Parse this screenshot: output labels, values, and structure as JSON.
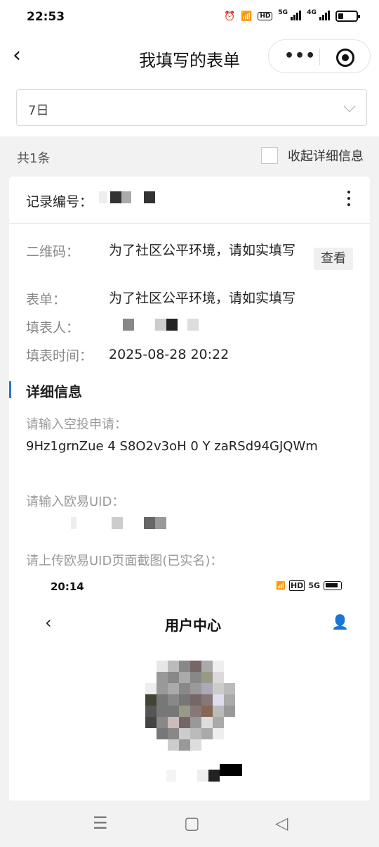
{
  "status_bar": {
    "time": "22:53",
    "network1": "5G",
    "network2": "4G",
    "hd": "HD",
    "icons": [
      "alarm-icon",
      "wifi-icon",
      "hd-icon",
      "signal-5g-icon",
      "signal-4g-icon",
      "battery-icon"
    ]
  },
  "nav": {
    "title": "我填写的表单"
  },
  "filter": {
    "selected": "7日"
  },
  "summary": {
    "count_text": "共1条",
    "collapse_label": "收起详细信息"
  },
  "record": {
    "id_label": "记录编号：",
    "fields": [
      {
        "key": "二维码：",
        "value": "为了社区公平环境，请如实填写"
      },
      {
        "key": "表单：",
        "value": "为了社区公平环境，请如实填写"
      },
      {
        "key": "填表人：",
        "value": ""
      },
      {
        "key": "填表时间：",
        "value": "2025-08-28 20:22"
      }
    ],
    "view_button": "查看"
  },
  "details": {
    "title": "详细信息",
    "questions": [
      {
        "label": "请输入空投申请：",
        "answer": "9Hz1grnZue 4 S8O2v3oH 0 Y zaRSd94GJQWm"
      },
      {
        "label": "请输入欧易UID：",
        "answer": ""
      },
      {
        "label": "请上传欧易UID页面截图(已实名)：",
        "answer": ""
      }
    ]
  },
  "screenshot": {
    "time": "20:14",
    "title": "用户中心",
    "hd": "HD",
    "network": "5G"
  },
  "bottom_nav": {
    "icons": [
      "menu-icon",
      "home-icon",
      "back-triangle-icon"
    ]
  },
  "colors": {
    "accent": "#2f6fdb",
    "background": "#f2f2f2"
  }
}
